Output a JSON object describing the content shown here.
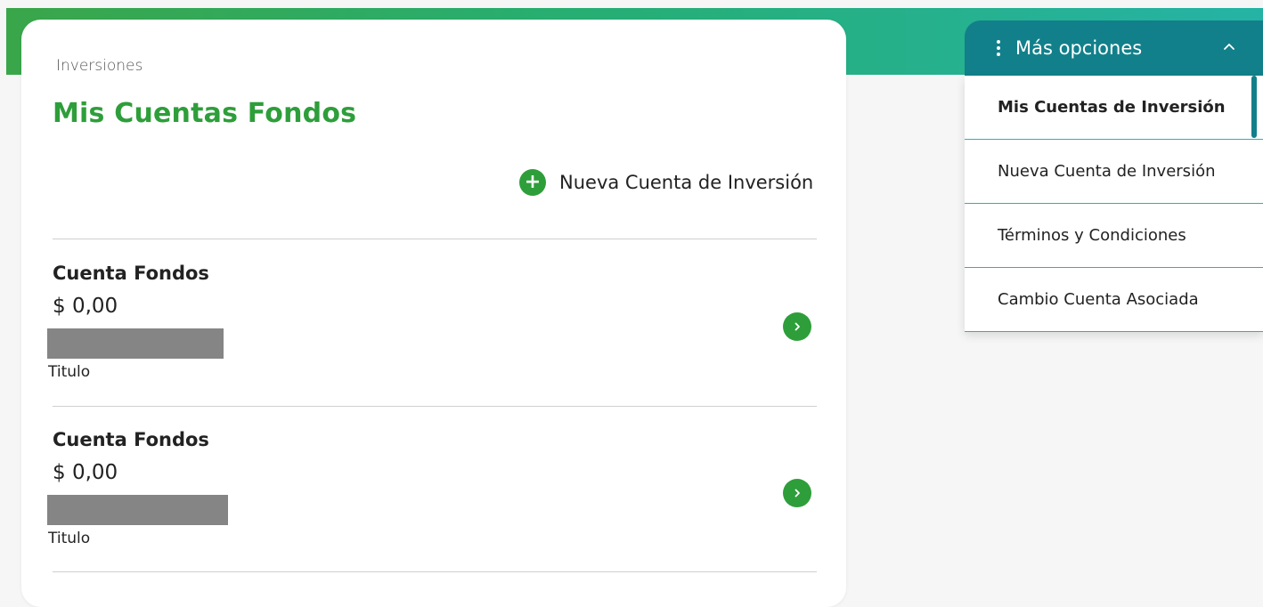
{
  "breadcrumb": "Inversiones",
  "page_title": "Mis Cuentas Fondos",
  "new_account_label": "Nueva Cuenta de Inversión",
  "accounts": [
    {
      "name": "Cuenta Fondos",
      "amount": "$ 0,00",
      "type": "Titulo"
    },
    {
      "name": "Cuenta Fondos",
      "amount": "$ 0,00",
      "type": "Titulo"
    }
  ],
  "options": {
    "title": "Más opciones",
    "items": [
      {
        "label": "Mis Cuentas de Inversión",
        "active": true
      },
      {
        "label": "Nueva Cuenta de Inversión",
        "active": false
      },
      {
        "label": "Términos y Condiciones",
        "active": false
      },
      {
        "label": "Cambio Cuenta Asociada",
        "active": false
      }
    ]
  },
  "colors": {
    "brand_green": "#2e9e3a",
    "teal": "#12808a",
    "teal_line": "#2bb0b8",
    "redaction_gray": "#858585"
  }
}
